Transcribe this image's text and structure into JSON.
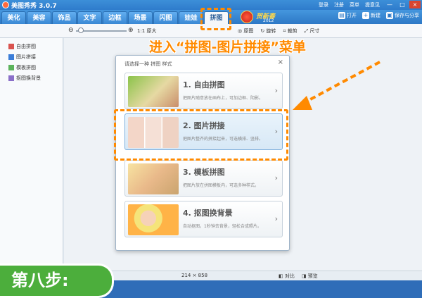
{
  "app": {
    "title": "美图秀秀 3.0.7"
  },
  "title_menu": [
    "登录",
    "注册",
    "菜单",
    "提意见"
  ],
  "window_controls": {
    "minimize": "—",
    "maximize": "□",
    "close": "×"
  },
  "tabs": [
    "美化",
    "美容",
    "饰品",
    "文字",
    "边框",
    "场景",
    "闪图",
    "娃娃",
    "拼图"
  ],
  "active_tab": "拼图",
  "festival": {
    "text": "贺新春",
    "year": "2012"
  },
  "top_actions": [
    {
      "icon": "folder-open-icon",
      "glyph": "▤",
      "label": "打开"
    },
    {
      "icon": "plus-icon",
      "glyph": "+",
      "label": "新建"
    },
    {
      "icon": "save-icon",
      "glyph": "▣",
      "label": "保存与分享"
    }
  ],
  "toolbar": {
    "zoom_out": "⊖",
    "zoom_in": "⊕",
    "zoom_level": 0.05,
    "original_size": "1:1 原大",
    "original": "◎ 原图",
    "rotate": "↻ 旋转",
    "crop": "⌗ 裁剪",
    "resize": "⤢ 尺寸"
  },
  "sidebar": {
    "items": [
      {
        "label": "自由拼图",
        "color": "#d9534f"
      },
      {
        "label": "图片拼接",
        "color": "#3b7dd8"
      },
      {
        "label": "模板拼图",
        "color": "#5bb35b"
      },
      {
        "label": "抠图换背景",
        "color": "#8a6fc9"
      }
    ]
  },
  "dialog": {
    "title": "请选择一种 拼图 样式",
    "close": "×",
    "options": [
      {
        "title": "1. 自由拼图",
        "desc": "把图片随意放在画布上，可加边框、阴影。",
        "arrow": "›"
      },
      {
        "title": "2. 图片拼接",
        "desc": "把图片整齐的拼接起来，可选横排、竖排。",
        "arrow": "›"
      },
      {
        "title": "3. 模板拼图",
        "desc": "把图片放在拼图模板内，可选多种样式。",
        "arrow": "›"
      },
      {
        "title": "4. 抠图换背景",
        "desc": "自动抠图，1秒钟去背景，轻松合成照片。",
        "arrow": "›"
      }
    ],
    "selected_index": 1
  },
  "statusbar": {
    "dimensions": "214 × 858",
    "compare": "◧ 对比",
    "preview": "◨ 预览"
  },
  "annotation": {
    "instruction": "进入“拼图-图片拼接”菜单",
    "step": "第八步:",
    "accent_color": "#ff8a00",
    "step_color": "#4cae3c"
  }
}
